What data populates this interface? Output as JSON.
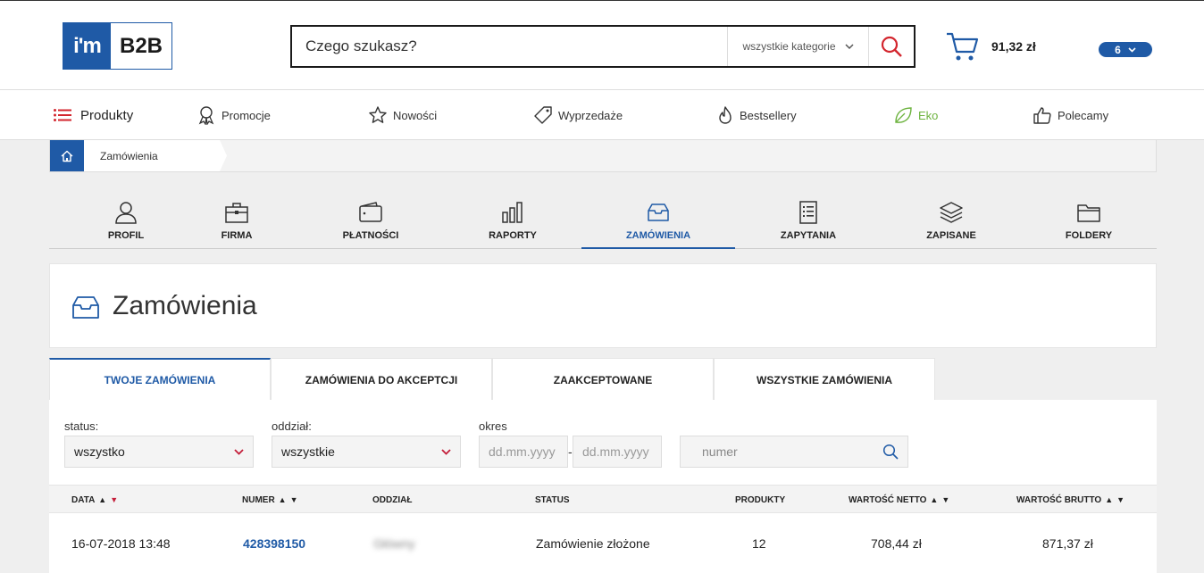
{
  "header": {
    "logo_mark": "i'm",
    "logo_text": "B2B",
    "search_placeholder": "Czego szukasz?",
    "search_category": "wszystkie kategorie",
    "cart_amount": "91,32 zł",
    "user_badge": "6",
    "accent_color": "#1f5aa6",
    "search_icon_color": "#d3262e"
  },
  "category_nav": {
    "items": [
      {
        "label": "Produkty",
        "icon": "menu-list-icon"
      },
      {
        "label": "Promocje",
        "icon": "award-icon"
      },
      {
        "label": "Nowości",
        "icon": "star-icon"
      },
      {
        "label": "Wyprzedaże",
        "icon": "tag-icon"
      },
      {
        "label": "Bestsellery",
        "icon": "flame-icon"
      },
      {
        "label": "Eko",
        "icon": "leaf-icon"
      },
      {
        "label": "Polecamy",
        "icon": "thumbs-up-icon"
      }
    ],
    "eko_color": "#6db33f"
  },
  "breadcrumb": {
    "current": "Zamówienia"
  },
  "account_tabs": [
    {
      "label": "PROFIL",
      "icon": "user-icon"
    },
    {
      "label": "FIRMA",
      "icon": "briefcase-icon"
    },
    {
      "label": "PŁATNOŚCI",
      "icon": "wallet-icon"
    },
    {
      "label": "RAPORTY",
      "icon": "bar-chart-icon"
    },
    {
      "label": "ZAMÓWIENIA",
      "icon": "inbox-icon",
      "active": true
    },
    {
      "label": "ZAPYTANIA",
      "icon": "document-list-icon"
    },
    {
      "label": "ZAPISANE",
      "icon": "layers-icon"
    },
    {
      "label": "FOLDERY",
      "icon": "folder-icon"
    }
  ],
  "page_title": "Zamówienia",
  "order_tabs": [
    {
      "label": "TWOJE ZAMÓWIENIA",
      "active": true
    },
    {
      "label": "ZAMÓWIENIA DO AKCEPTCJI"
    },
    {
      "label": "ZAAKCEPTOWANE"
    },
    {
      "label": "WSZYSTKIE ZAMÓWIENIA"
    }
  ],
  "filters": {
    "status_label": "status:",
    "status_value": "wszystko",
    "branch_label": "oddział:",
    "branch_value": "wszystkie",
    "period_label": "okres",
    "date_from_placeholder": "dd.mm.yyyy",
    "date_separator": "-",
    "date_to_placeholder": "dd.mm.yyyy",
    "number_placeholder": "numer"
  },
  "table": {
    "columns": [
      "DATA",
      "NUMER",
      "ODDZIAŁ",
      "STATUS",
      "PRODUKTY",
      "WARTOŚĆ NETTO",
      "WARTOŚĆ BRUTTO"
    ],
    "rows": [
      {
        "date": "16-07-2018 13:48",
        "number": "428398150",
        "branch": "Główny",
        "status": "Zamówienie złożone",
        "products": "12",
        "net": "708,44 zł",
        "gross": "871,37 zł"
      }
    ]
  }
}
